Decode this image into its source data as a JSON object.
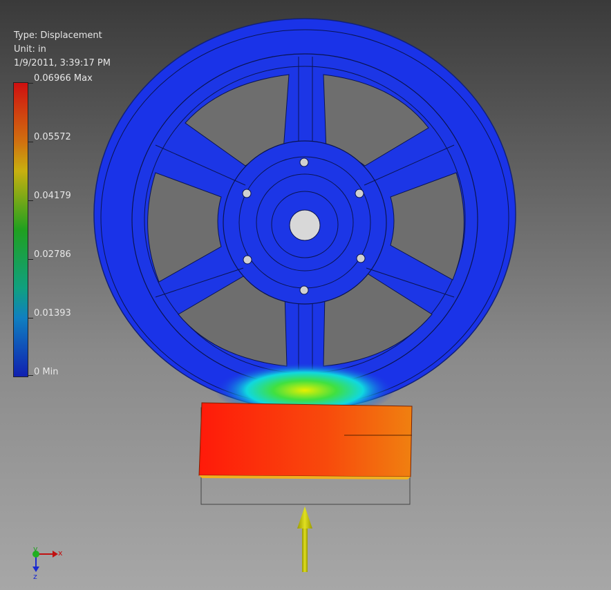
{
  "info": {
    "type_line": "Type: Displacement",
    "unit_line": "Unit: in",
    "timestamp": "1/9/2011, 3:39:17 PM"
  },
  "legend": {
    "ticks": [
      "0.06966 Max",
      "0.05572",
      "0.04179",
      "0.02786",
      "0.01393",
      "0 Min"
    ]
  },
  "axes": {
    "x": "x",
    "y": "y",
    "z": "z"
  },
  "colors": {
    "wheel": "#1a33e0",
    "block_hot": "#f02010",
    "block_warm": "#f07010",
    "arrow": "#c8c800",
    "background_top": "#3a3a3a",
    "background_bottom": "#a7a7a7"
  },
  "icons": {
    "load_arrow": "arrow-up-icon",
    "triad": "coordinate-triad-icon"
  }
}
